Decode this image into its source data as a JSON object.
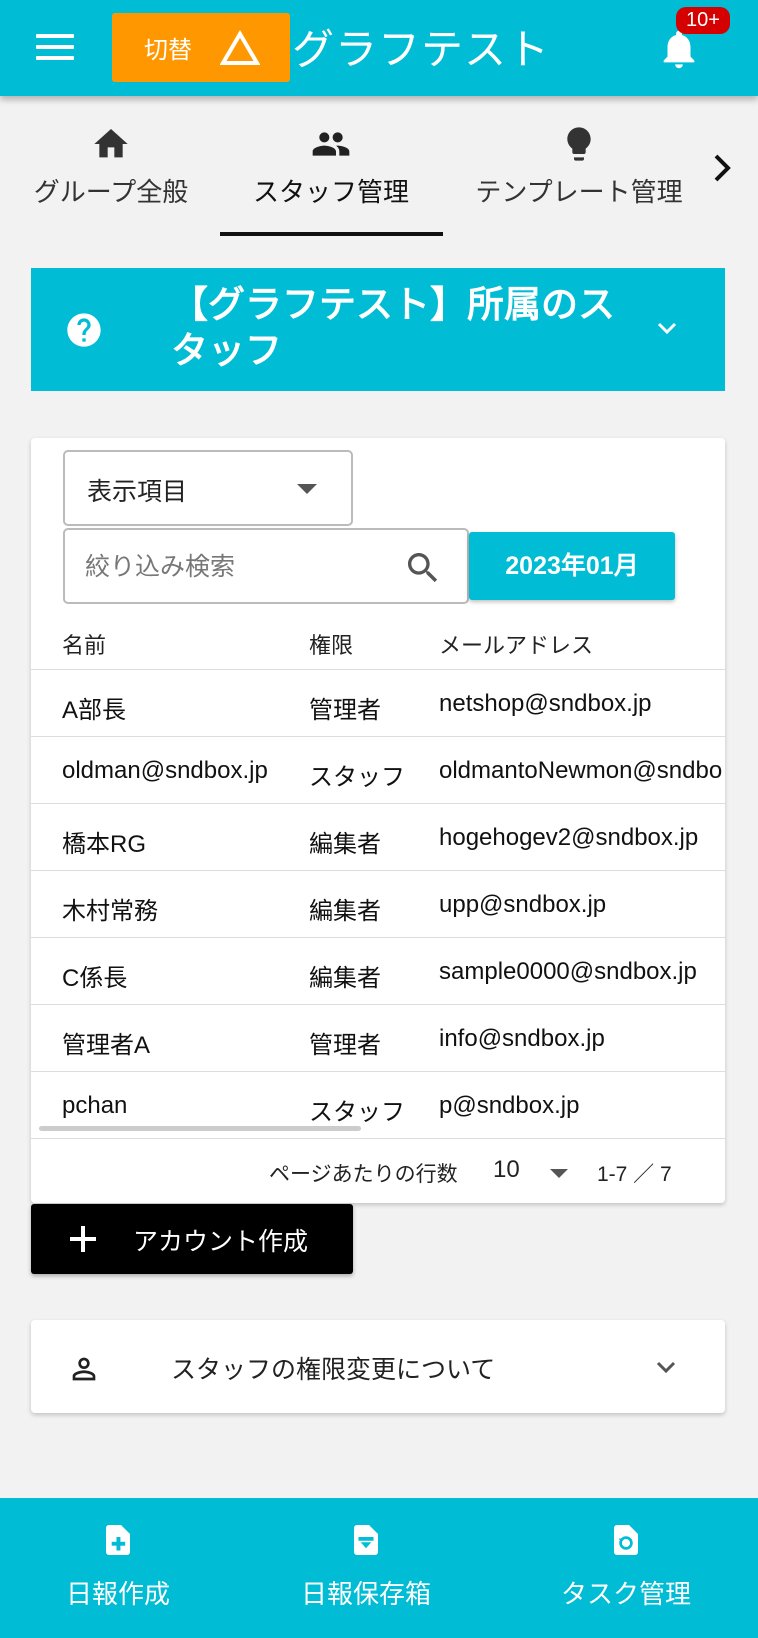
{
  "header": {
    "switch_label": "切替",
    "title": "グラフテスト",
    "notification_badge": "10+"
  },
  "tabs": [
    {
      "label": "グループ全般",
      "icon": "home-icon",
      "active": false
    },
    {
      "label": "スタッフ管理",
      "icon": "people-icon",
      "active": true
    },
    {
      "label": "テンプレート管理",
      "icon": "lightbulb-icon",
      "active": false
    }
  ],
  "banner": {
    "title": "【グラフテスト】所属のスタッフ"
  },
  "controls": {
    "display_items_label": "表示項目",
    "search_placeholder": "絞り込み検索",
    "month_button": "2023年01月"
  },
  "table": {
    "columns": [
      "名前",
      "権限",
      "メールアドレス"
    ],
    "rows": [
      {
        "name": "A部長",
        "role": "管理者",
        "email": "netshop@sndbox.jp"
      },
      {
        "name": "oldman@sndbox.jp",
        "role": "スタッフ",
        "email": "oldmantoNewmon@sndbo"
      },
      {
        "name": "橋本RG",
        "role": "編集者",
        "email": "hogehogev2@sndbox.jp"
      },
      {
        "name": "木村常務",
        "role": "編集者",
        "email": "upp@sndbox.jp"
      },
      {
        "name": "C係長",
        "role": "編集者",
        "email": "sample0000@sndbox.jp"
      },
      {
        "name": "管理者A",
        "role": "管理者",
        "email": "info@sndbox.jp"
      },
      {
        "name": "pchan",
        "role": "スタッフ",
        "email": "p@sndbox.jp"
      }
    ]
  },
  "pagination": {
    "rows_per_page_label": "ページあたりの行数",
    "rows_per_page": "10",
    "range": "1-7 ／ 7"
  },
  "create_account_label": "アカウント作成",
  "info_accordion_label": "スタッフの権限変更について",
  "bottom_nav": [
    {
      "label": "日報作成",
      "icon": "file-add-icon"
    },
    {
      "label": "日報保存箱",
      "icon": "archive-icon"
    },
    {
      "label": "タスク管理",
      "icon": "task-refresh-icon"
    }
  ],
  "colors": {
    "primary": "#00bcd4",
    "accent": "#ff9800",
    "badge": "#d50000"
  }
}
